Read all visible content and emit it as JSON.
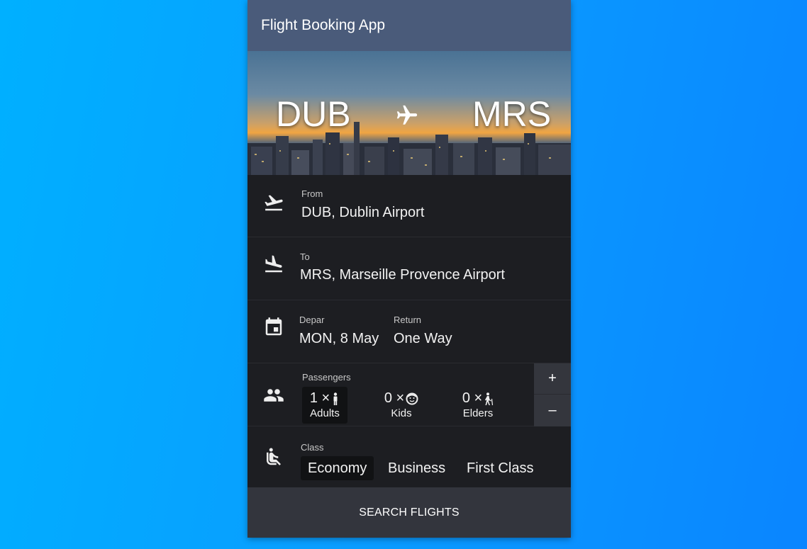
{
  "app": {
    "title": "Flight Booking App"
  },
  "hero": {
    "from_code": "DUB",
    "to_code": "MRS"
  },
  "from": {
    "label": "From",
    "value": "DUB, Dublin Airport"
  },
  "to": {
    "label": "To",
    "value": "MRS, Marseille Provence Airport"
  },
  "dates": {
    "depart_label": "Depar",
    "depart_value": "MON, 8 May",
    "return_label": "Return",
    "return_value": "One Way"
  },
  "passengers": {
    "label": "Passengers",
    "items": [
      {
        "count": "1 ×",
        "name": "Adults",
        "icon": "adult-icon",
        "active": true
      },
      {
        "count": "0 ×",
        "name": "Kids",
        "icon": "kid-icon",
        "active": false
      },
      {
        "count": "0 ×",
        "name": "Elders",
        "icon": "elder-icon",
        "active": false
      }
    ],
    "plus": "+",
    "minus": "–"
  },
  "class": {
    "label": "Class",
    "options": [
      "Economy",
      "Business",
      "First Class"
    ],
    "selected": "Economy"
  },
  "search_button": "SEARCH FLIGHTS",
  "colors": {
    "background": "#0a9cff",
    "titlebar": "#4a5b7a",
    "panel": "#1d1e22",
    "button": "#33353d"
  }
}
